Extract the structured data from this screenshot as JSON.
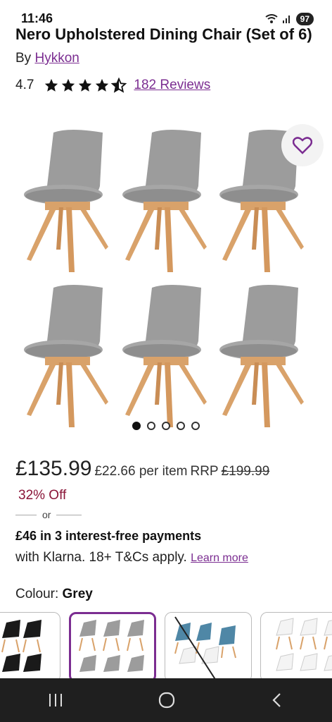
{
  "status": {
    "time": "11:46",
    "battery": "97"
  },
  "product": {
    "title": "Nero Upholstered Dining Chair (Set of 6)",
    "by_prefix": "By",
    "brand": "Hykkon",
    "rating": "4.7",
    "reviews": "182 Reviews"
  },
  "gallery": {
    "image_count": 5,
    "active_index": 0
  },
  "pricing": {
    "price": "£135.99",
    "per_item": "£22.66 per item",
    "rrp_label": "RRP",
    "rrp_value": "£199.99",
    "discount": "32% Off",
    "or": "or"
  },
  "klarna": {
    "title": "£46 in 3 interest-free payments",
    "text": "with Klarna. 18+ T&Cs apply.",
    "learn_more": "Learn more"
  },
  "colour": {
    "label": "Colour:",
    "value": "Grey"
  },
  "colors": {
    "accent": "#7b2d91",
    "discount": "#8a1538",
    "chair_seat": "#9a9a9a",
    "chair_legs": "#d9a26a"
  },
  "nav": {
    "recent": "recent-apps-icon",
    "home": "home-icon",
    "back": "back-icon"
  }
}
